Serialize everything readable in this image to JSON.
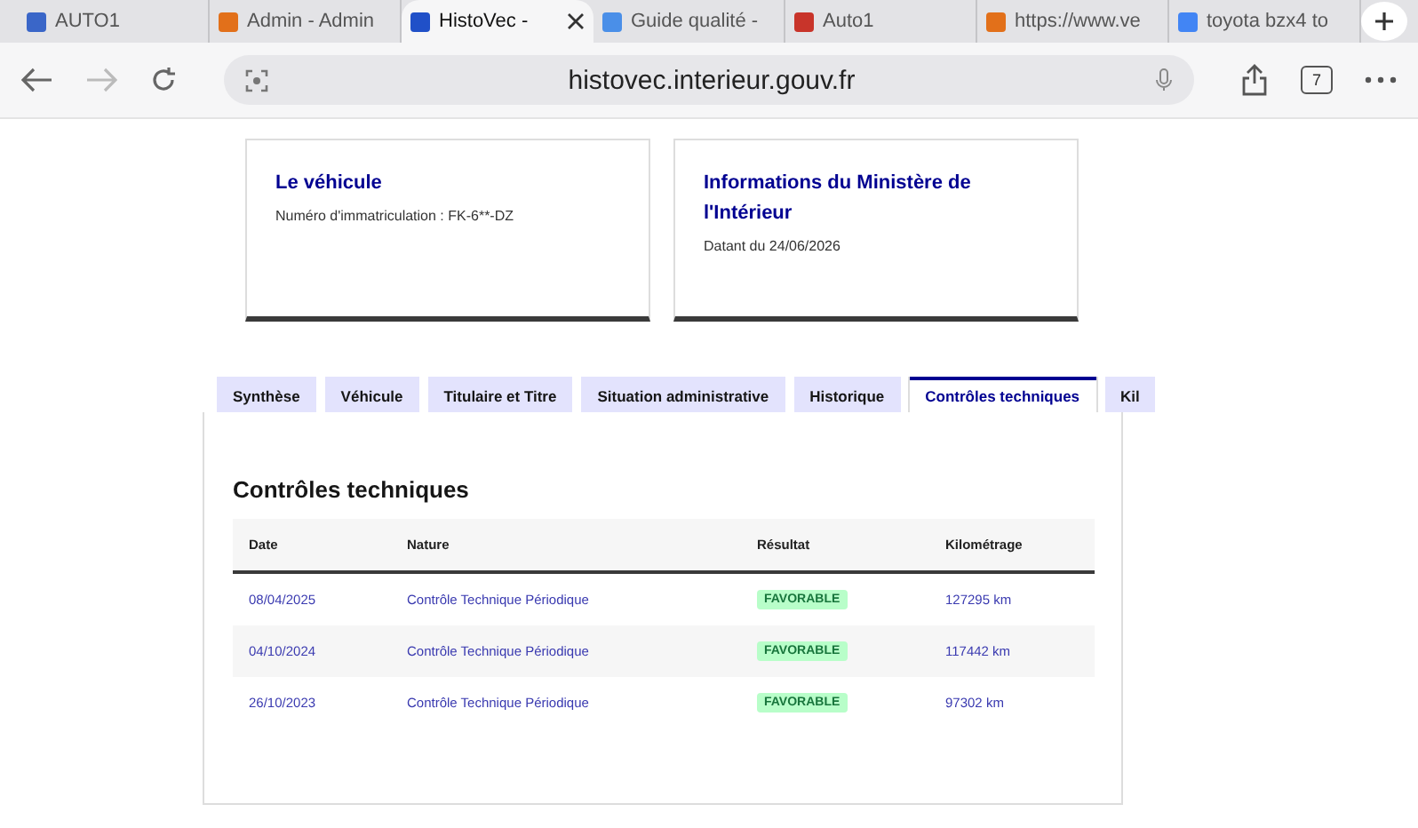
{
  "browser_tabs": [
    {
      "title": "AUTO1",
      "selected": false
    },
    {
      "title": "Admin - Admin",
      "selected": false
    },
    {
      "title": "HistoVec -",
      "selected": true
    },
    {
      "title": "Guide qualité -",
      "selected": false
    },
    {
      "title": "Auto1",
      "selected": false
    },
    {
      "title": "https://www.ve",
      "selected": false
    },
    {
      "title": "toyota bzx4 to",
      "selected": false
    }
  ],
  "address_bar": {
    "url": "histovec.interieur.gouv.fr",
    "tab_count": "7"
  },
  "cards": [
    {
      "title": "Le véhicule",
      "text": "Numéro d'immatriculation : FK-6**-DZ"
    },
    {
      "title": "Informations du Ministère de l'Intérieur",
      "text": "Datant du 24/06/2026"
    }
  ],
  "page_tabs": [
    {
      "label": "Synthèse",
      "selected": false
    },
    {
      "label": "Véhicule",
      "selected": false
    },
    {
      "label": "Titulaire et Titre",
      "selected": false
    },
    {
      "label": "Situation administrative",
      "selected": false
    },
    {
      "label": "Historique",
      "selected": false
    },
    {
      "label": "Contrôles techniques",
      "selected": true
    },
    {
      "label": "Kil",
      "selected": false
    }
  ],
  "section": {
    "title": "Contrôles techniques",
    "table": {
      "columns": [
        "Date",
        "Nature",
        "Résultat",
        "Kilométrage"
      ],
      "rows": [
        {
          "date": "08/04/2025",
          "nature": "Contrôle Technique Périodique",
          "result": "FAVORABLE",
          "mileage": "127295 km"
        },
        {
          "date": "04/10/2024",
          "nature": "Contrôle Technique Périodique",
          "result": "FAVORABLE",
          "mileage": "117442 km"
        },
        {
          "date": "26/10/2023",
          "nature": "Contrôle Technique Périodique",
          "result": "FAVORABLE",
          "mileage": "97302 km"
        }
      ]
    }
  }
}
